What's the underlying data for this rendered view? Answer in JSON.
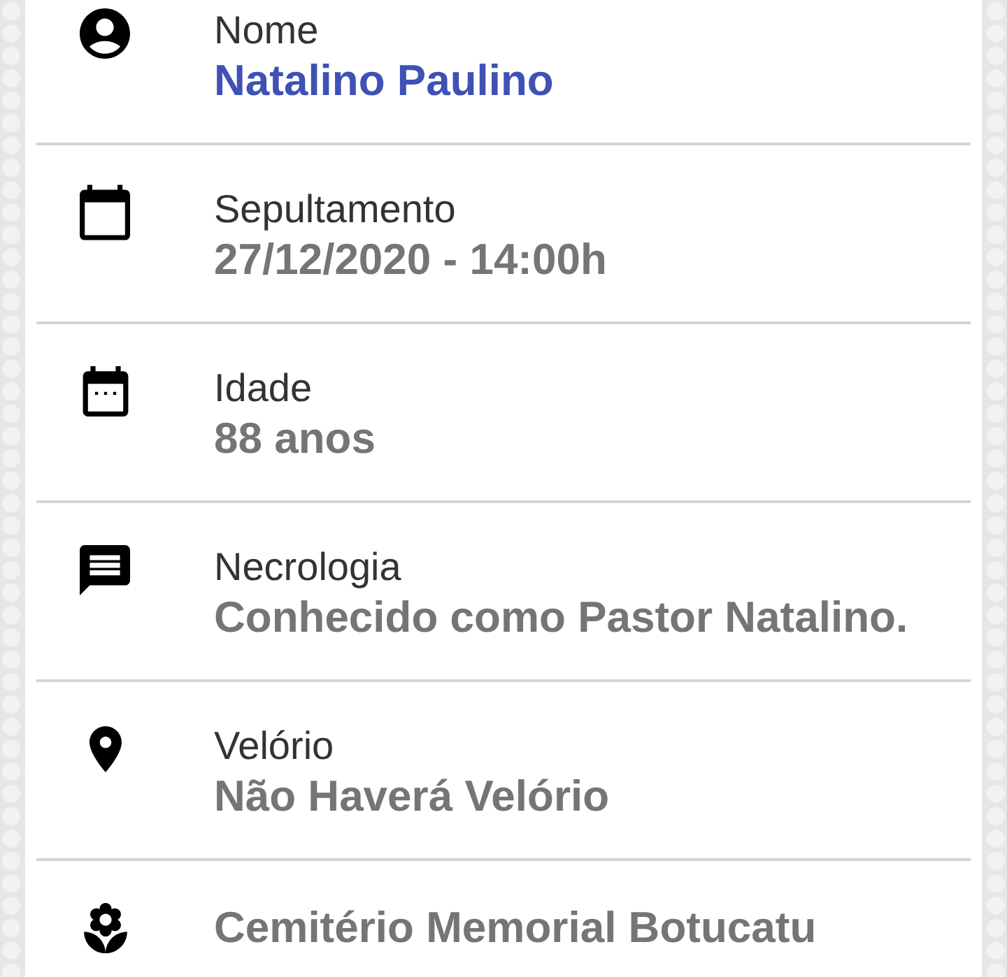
{
  "rows": [
    {
      "kind": "name",
      "label": "Nome",
      "value": "Natalino Paulino"
    },
    {
      "kind": "burial",
      "label": "Sepultamento",
      "value": "27/12/2020 - 14:00h"
    },
    {
      "kind": "age",
      "label": "Idade",
      "value": "88 anos"
    },
    {
      "kind": "obituary",
      "label": "Necrologia",
      "value": "Conhecido como Pastor Natalino."
    },
    {
      "kind": "wake",
      "label": "Velório",
      "value": "Não Haverá Velório"
    },
    {
      "kind": "cemetery",
      "value": "Cemitério Memorial Botucatu"
    }
  ]
}
